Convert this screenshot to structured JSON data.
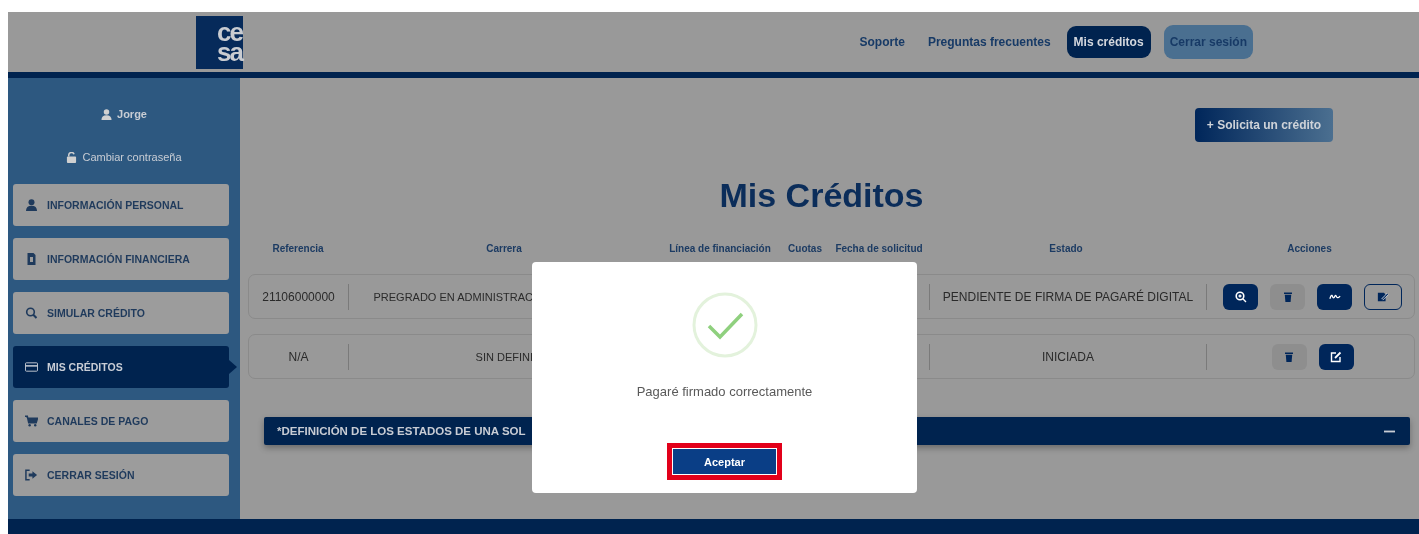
{
  "header": {
    "logo": [
      "ce",
      "sa"
    ],
    "nav": [
      {
        "label": "Soporte",
        "kind": "link",
        "selected": false
      },
      {
        "label": "Preguntas frecuentes",
        "kind": "link",
        "selected": false
      },
      {
        "label": "Mis créditos",
        "kind": "link",
        "selected": true
      },
      {
        "label": "Cerrar sesión",
        "kind": "button",
        "selected": false
      }
    ]
  },
  "sidebar": {
    "user": "Jorge",
    "change_password": "Cambiar contraseña",
    "items": [
      {
        "label": "INFORMACIÓN PERSONAL",
        "selected": false
      },
      {
        "label": "INFORMACIÓN FINANCIERA",
        "selected": false
      },
      {
        "label": "SIMULAR CRÉDITO",
        "selected": false
      },
      {
        "label": "MIS CRÉDITOS",
        "selected": true
      },
      {
        "label": "CANALES DE PAGO",
        "selected": false
      },
      {
        "label": "CERRAR SESIÓN",
        "selected": false
      }
    ]
  },
  "main": {
    "new_credit_button": "+ Solicita un crédito",
    "title": "Mis Créditos",
    "table": {
      "columns": [
        "Referencia",
        "Carrera",
        "Línea de financiación",
        "Cuotas",
        "Fecha de solicitud",
        "Estado",
        "Acciones"
      ],
      "rows": [
        {
          "reference": "21106000000",
          "career": "PREGRADO EN ADMINISTRAC",
          "status": "PENDIENTE DE FIRMA DE PAGARÉ DIGITAL",
          "actions": [
            {
              "kind": "view"
            },
            {
              "kind": "delete"
            },
            {
              "kind": "sign"
            },
            {
              "kind": "document"
            }
          ]
        },
        {
          "reference": "N/A",
          "career": "SIN DEFINI",
          "status": "INICIADA",
          "actions": [
            {
              "kind": "delete"
            },
            {
              "kind": "edit"
            }
          ]
        }
      ]
    },
    "states_panel": {
      "title": "*DEFINICIÓN DE LOS ESTADOS DE UNA SOL",
      "expanded": true
    }
  },
  "dialog": {
    "message": "Pagaré firmado correctamente",
    "button": {
      "label": "Aceptar",
      "highlighted": true
    }
  }
}
